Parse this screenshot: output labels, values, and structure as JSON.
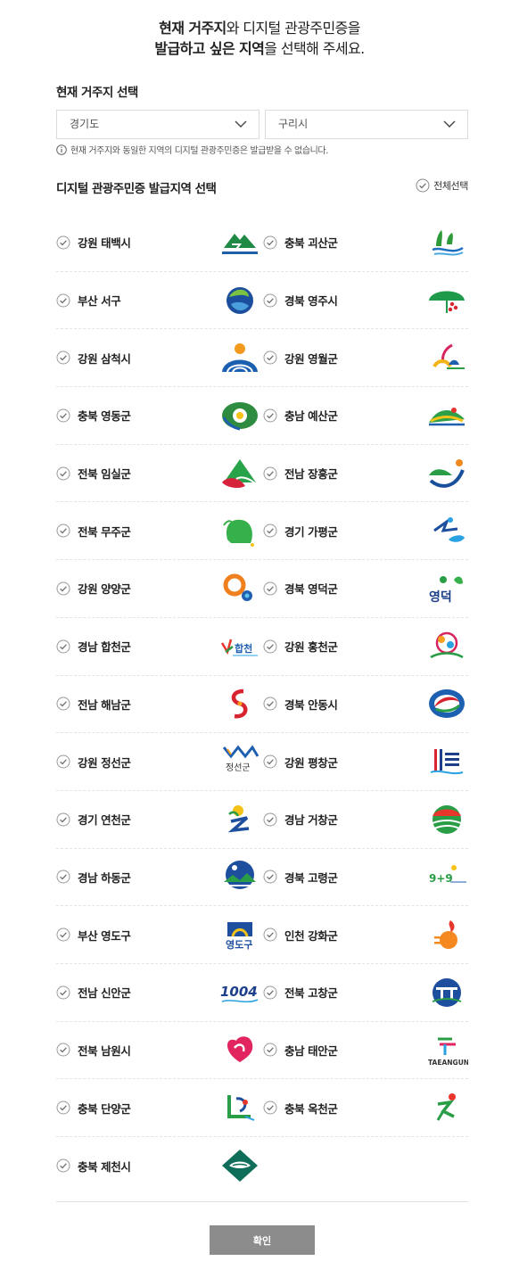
{
  "header": {
    "line1_bold": "현재 거주지",
    "line1_rest": "와 디지털 관광주민증을",
    "line2_bold": "발급하고 싶은 지역",
    "line2_rest": "을 선택해 주세요."
  },
  "residence": {
    "title": "현재 거주지 선택",
    "province": "경기도",
    "city": "구리시",
    "notice": "현재 거주지와 동일한 지역의 디지털 관광주민증은 발급받을 수 없습니다."
  },
  "regions": {
    "title": "디지털 관광주민증 발급지역 선택",
    "select_all": "전체선택",
    "items": [
      {
        "label": "강원 태백시",
        "icon": "taebaek-logo"
      },
      {
        "label": "충북 괴산군",
        "icon": "goesan-logo"
      },
      {
        "label": "부산 서구",
        "icon": "busan-seogu-logo"
      },
      {
        "label": "경북 영주시",
        "icon": "yeongju-logo"
      },
      {
        "label": "강원 삼척시",
        "icon": "samcheok-logo"
      },
      {
        "label": "강원 영월군",
        "icon": "yeongwol-logo"
      },
      {
        "label": "충북 영동군",
        "icon": "yeongdong-logo"
      },
      {
        "label": "충남 예산군",
        "icon": "yesan-logo"
      },
      {
        "label": "전북 임실군",
        "icon": "imsil-logo"
      },
      {
        "label": "전남 장흥군",
        "icon": "jangheung-logo"
      },
      {
        "label": "전북 무주군",
        "icon": "muju-logo"
      },
      {
        "label": "경기 가평군",
        "icon": "gapyeong-logo"
      },
      {
        "label": "강원 양양군",
        "icon": "yangyang-logo"
      },
      {
        "label": "경북 영덕군",
        "icon": "yeongdeok-logo"
      },
      {
        "label": "경남 합천군",
        "icon": "hapcheon-logo"
      },
      {
        "label": "강원 홍천군",
        "icon": "hongcheon-logo"
      },
      {
        "label": "전남 해남군",
        "icon": "haenam-logo"
      },
      {
        "label": "경북 안동시",
        "icon": "andong-logo"
      },
      {
        "label": "강원 정선군",
        "icon": "jeongseon-logo"
      },
      {
        "label": "강원 평창군",
        "icon": "pyeongchang-logo"
      },
      {
        "label": "경기 연천군",
        "icon": "yeoncheon-logo"
      },
      {
        "label": "경남 거창군",
        "icon": "geochang-logo"
      },
      {
        "label": "경남 하동군",
        "icon": "hadong-logo"
      },
      {
        "label": "경북 고령군",
        "icon": "goryeong-logo"
      },
      {
        "label": "부산 영도구",
        "icon": "yeongdo-logo"
      },
      {
        "label": "인천 강화군",
        "icon": "ganghwa-logo"
      },
      {
        "label": "전남 신안군",
        "icon": "sinan-logo"
      },
      {
        "label": "전북 고창군",
        "icon": "gochang-logo"
      },
      {
        "label": "전북 남원시",
        "icon": "namwon-logo"
      },
      {
        "label": "충남 태안군",
        "icon": "taean-logo"
      },
      {
        "label": "충북 단양군",
        "icon": "danyang-logo"
      },
      {
        "label": "충북 옥천군",
        "icon": "okcheon-logo"
      },
      {
        "label": "충북 제천시",
        "icon": "jecheon-logo"
      }
    ],
    "logo_text": {
      "jeongseon": "정선군",
      "yeongdeok": "영덕",
      "yeongdo": "영도구",
      "sinan": "1004",
      "taean": "TAEANGUN",
      "hapcheon": "합천",
      "goryeong": "9+9"
    }
  },
  "confirm_label": "확인",
  "colors": {
    "check": "#777777",
    "button": "#8c8c8c",
    "divider": "#e3e3e3"
  }
}
